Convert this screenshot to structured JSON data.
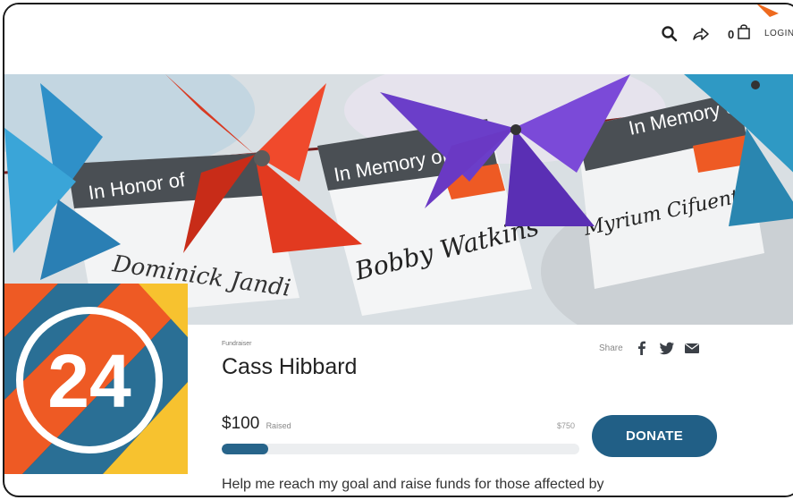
{
  "header": {
    "cart_count": "0",
    "login_label": "LOGIN"
  },
  "hero": {
    "tags": [
      "In Honor of",
      "In Memory of",
      "In Memory of"
    ],
    "signatures": [
      "Dominick Jandi",
      "Bobby Watkins",
      "Myrium Cifuentes"
    ]
  },
  "logo": {
    "text": "24"
  },
  "fundraiser": {
    "kicker": "Fundraiser",
    "name": "Cass Hibbard",
    "share_label": "Share",
    "raised_amount": "$100",
    "raised_label": "Raised",
    "goal": "$750",
    "progress_fraction": 0.13,
    "donate_label": "DONATE",
    "description": "Help me reach my goal and raise funds for those affected by"
  },
  "icons": {
    "search": "search-icon",
    "share": "share-arrow-icon",
    "cart": "shopping-bag-icon",
    "facebook": "facebook-icon",
    "twitter": "twitter-icon",
    "email": "email-icon"
  },
  "colors": {
    "accent": "#215f86",
    "orange": "#ee5a24",
    "yellow": "#f7c22f",
    "teal": "#2a6f95",
    "dark": "#2c2f33"
  }
}
